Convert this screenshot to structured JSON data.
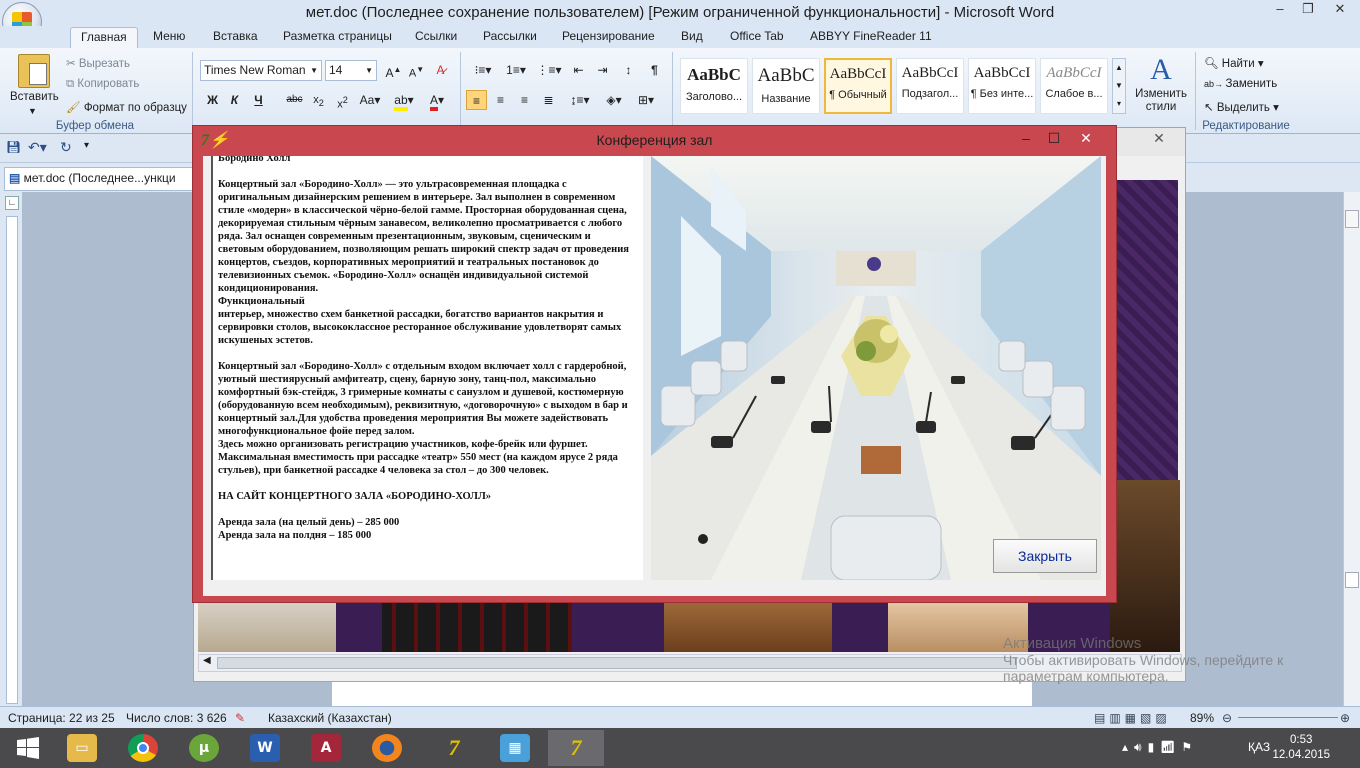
{
  "window": {
    "title": "мет.doc (Последнее сохранение пользователем) [Режим ограниченной функциональности] - Microsoft Word"
  },
  "tabs": [
    "Главная",
    "Меню",
    "Вставка",
    "Разметка страницы",
    "Ссылки",
    "Рассылки",
    "Рецензирование",
    "Вид",
    "Office Tab",
    "ABBYY FineReader 11"
  ],
  "clipboard": {
    "paste": "Вставить",
    "cut": "Вырезать",
    "copy": "Копировать",
    "format_painter": "Формат по образцу",
    "group": "Буфер обмена"
  },
  "font": {
    "family": "Times New Roman",
    "size": "14"
  },
  "styles": [
    {
      "sample": "AaBbC",
      "name": "Заголово..."
    },
    {
      "sample": "AaBbC",
      "name": "Название"
    },
    {
      "sample": "AaBbCcI",
      "name": "¶ Обычный"
    },
    {
      "sample": "AaBbCcI",
      "name": "Подзагол..."
    },
    {
      "sample": "AaBbCcI",
      "name": "¶ Без инте..."
    },
    {
      "sample": "AaBbCcI",
      "name": "Слабое в..."
    }
  ],
  "change_styles": "Изменить стили",
  "editing": {
    "find": "Найти",
    "replace": "Заменить",
    "select": "Выделить",
    "group": "Редактирование"
  },
  "doc_tab": "мет.doc (Последнее...ункци",
  "dialog": {
    "title": "Конференция зал",
    "heading": "Бородино Холл",
    "paragraphs": [
      "Концертный зал «Бородино-Холл» — это ультрасовременная площадка с оригинальным дизайнерским решением  в интерьере. Зал выполнен в современном стиле «модерн» в классической чёрно-белой гамме.  Просторная оборудованная сцена, декорируемая стильным чёрным занавесом, великолепно просматривается с любого ряда. Зал оснащен современным презентационным, звуковым, сценическим и световым оборудованием, позволяющим решать широкий спектр задач от проведения концертов, съездов, корпоративных мероприятий и театральных постановок до телевизионных съемок. «Бородино-Холл» оснащён индивидуальной системой кондиционирования.",
      "Функциональный",
      "интерьер, множество схем банкетной рассадки, богатство вариантов накрытия и",
      "сервировки столов, высококлассное ресторанное обслуживание  удовлетворят самых искушеных эстетов.",
      "",
      "Концертный зал «Бородино-Холл» с отдельным входом включает холл с гардеробной, уютный шестиярусный амфитеатр, сцену, барную зону, танц-пол, максимально комфортный бэк-стейдж, 3 гримерные комнаты с  санузлом и душевой, костюмерную (оборудованную всем необходимым), реквизитную, «договорочную» с выходом в бар и концертный зал.Для удобства проведения мероприятия Вы можете задействовать многофункциональное фойе перед залом.",
      "Здесь можно организовать регистрацию участников, кофе-брейк или фуршет.",
      "Максимальная вместимость при рассадке «театр» 550 мест (на каждом ярусе 2 ряда стульев), при банкетной рассадке 4 человека за стол – до 300 человек.",
      "",
      "НА САЙТ КОНЦЕРТНОГО ЗАЛА «БОРОДИНО-ХОЛЛ»",
      "",
      "Аренда зала (на целый день) – 285 000",
      "Аренда зала на полдня – 185 000"
    ],
    "close_label": "Закрыть"
  },
  "status": {
    "page": "Страница: 22 из 25",
    "words": "Число слов: 3 626",
    "lang": "Казахский (Казахстан)",
    "zoom": "89%"
  },
  "activate": {
    "line1": "Активация Windows",
    "line2": "Чтобы активировать Windows, перейдите к",
    "line3": "параметрам компьютера."
  },
  "taskbar": {
    "lang": "ҚАЗ",
    "time": "0:53",
    "date": "12.04.2015"
  }
}
